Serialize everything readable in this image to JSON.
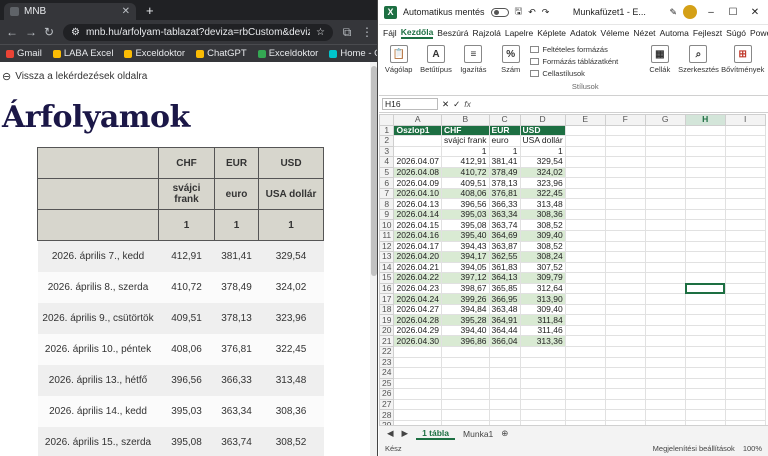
{
  "browser": {
    "tab_title": "MNB",
    "url": "mnb.hu/arfolyam-tablazat?deviza=rbCustom&devizaSel...",
    "bookmarks": [
      "Gmail",
      "LABA Excel",
      "Exceldoktor",
      "ChatGPT",
      "Exceldoktor",
      "Home - Canva"
    ],
    "page": {
      "back_link": "Vissza a lekérdezések oldalra",
      "heading": "Árfolyamok",
      "header_rows": [
        [
          "",
          "CHF",
          "EUR",
          "USD"
        ],
        [
          "",
          "svájci frank",
          "euro",
          "USA dollár"
        ],
        [
          "",
          "1",
          "1",
          "1"
        ]
      ],
      "rows": [
        [
          "2026. április 7., kedd",
          "412,91",
          "381,41",
          "329,54"
        ],
        [
          "2026. április 8., szerda",
          "410,72",
          "378,49",
          "324,02"
        ],
        [
          "2026. április 9., csütörtök",
          "409,51",
          "378,13",
          "323,96"
        ],
        [
          "2026. április 10., péntek",
          "408,06",
          "376,81",
          "322,45"
        ],
        [
          "2026. április 13., hétfő",
          "396,56",
          "366,33",
          "313,48"
        ],
        [
          "2026. április 14., kedd",
          "395,03",
          "363,34",
          "308,36"
        ],
        [
          "2026. április 15., szerda",
          "395,08",
          "363,74",
          "308,52"
        ]
      ]
    }
  },
  "excel": {
    "autosave_label": "Automatikus mentés",
    "file_title": "Munkafüzet1 - E...",
    "menu": [
      "Fájl",
      "Kezdőla",
      "Beszúrá",
      "Rajzolá",
      "Lapelre",
      "Képlete",
      "Adatok",
      "Véleme",
      "Nézet",
      "Automa",
      "Fejleszt",
      "Súgó",
      "Power P"
    ],
    "ribbon": {
      "clipboard": "Vágólap",
      "font": "Betűtípus",
      "align": "Igazítás",
      "number": "Szám",
      "cond_format": "Feltételes formázás",
      "table_format": "Formázás táblázatként",
      "cell_styles": "Cellastílusok",
      "styles_group": "Stílusok",
      "cells": "Cellák",
      "editing": "Szerkesztés",
      "addins": "Bővítmények",
      "addins_group": "Bővítmények"
    },
    "name_box": "H16",
    "col_headers": [
      "A",
      "B",
      "C",
      "D",
      "E",
      "F",
      "G",
      "H",
      "I"
    ],
    "grid_header": [
      "Oszlop1",
      "CHF",
      "EUR",
      "USD"
    ],
    "grid_row2": [
      "",
      "svájci frank",
      "euro",
      "USA dollár"
    ],
    "grid_row3": [
      "",
      "1",
      "1",
      "1"
    ],
    "grid_rows": [
      [
        "2026.04.07",
        "412,91",
        "381,41",
        "329,54"
      ],
      [
        "2026.04.08",
        "410,72",
        "378,49",
        "324,02"
      ],
      [
        "2026.04.09",
        "409,51",
        "378,13",
        "323,96"
      ],
      [
        "2026.04.10",
        "408,06",
        "376,81",
        "322,45"
      ],
      [
        "2026.04.13",
        "396,56",
        "366,33",
        "313,48"
      ],
      [
        "2026.04.14",
        "395,03",
        "363,34",
        "308,36"
      ],
      [
        "2026.04.15",
        "395,08",
        "363,74",
        "308,52"
      ],
      [
        "2026.04.16",
        "395,40",
        "364,69",
        "309,40"
      ],
      [
        "2026.04.17",
        "394,43",
        "363,87",
        "308,52"
      ],
      [
        "2026.04.20",
        "394,17",
        "362,55",
        "308,24"
      ],
      [
        "2026.04.21",
        "394,05",
        "361,83",
        "307,52"
      ],
      [
        "2026.04.22",
        "397,12",
        "364,13",
        "309,79"
      ],
      [
        "2026.04.23",
        "398,67",
        "365,85",
        "312,64"
      ],
      [
        "2026.04.24",
        "399,26",
        "366,95",
        "313,90"
      ],
      [
        "2026.04.27",
        "394,84",
        "363,48",
        "309,40"
      ],
      [
        "2026.04.28",
        "395,28",
        "364,91",
        "311,84"
      ],
      [
        "2026.04.29",
        "394,40",
        "364,44",
        "311,46"
      ],
      [
        "2026.04.30",
        "396,86",
        "366,04",
        "313,36"
      ]
    ],
    "sheet_tabs": [
      "1 tábla",
      "Munka1"
    ],
    "status_ready": "Kész",
    "status_a11y": "Megjelenítési beállítások",
    "zoom": "100%"
  }
}
